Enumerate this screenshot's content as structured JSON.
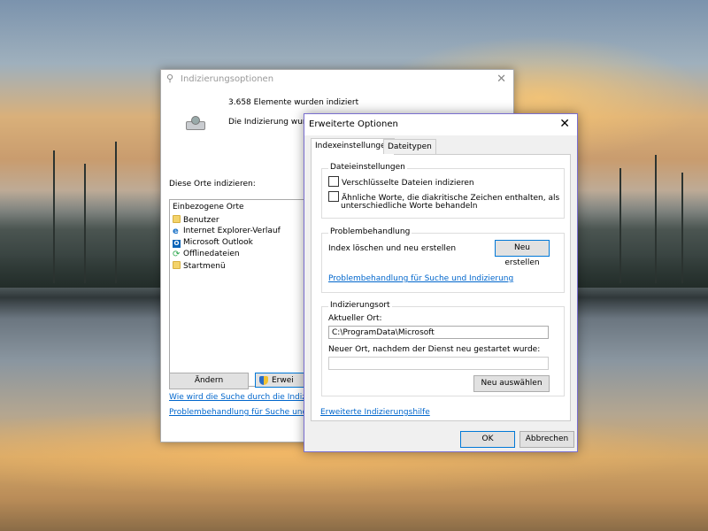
{
  "indexing_window": {
    "title": "Indizierungsoptionen",
    "title_icon": "magnifier-icon",
    "close_glyph": "✕",
    "count_text": "3.658 Elemente wurden indiziert",
    "status_text": "Die Indizierung wurde",
    "locations_label": "Diese Orte indizieren:",
    "locations_header": "Einbezogene Orte",
    "locations": [
      {
        "label": "Benutzer",
        "icon": "folder-icon"
      },
      {
        "label": "Internet Explorer-Verlauf",
        "icon": "internet-explorer-icon"
      },
      {
        "label": "Microsoft Outlook",
        "icon": "outlook-icon"
      },
      {
        "label": "Offlinedateien",
        "icon": "sync-icon"
      },
      {
        "label": "Startmenü",
        "icon": "folder-icon"
      }
    ],
    "modify_button": "Ändern",
    "advanced_button": "Erwei",
    "link_how_search": "Wie wird die Suche durch die Indizierun",
    "link_troubleshoot": "Problembehandlung für Suche und Indizi"
  },
  "advanced_dialog": {
    "title": "Erweiterte Optionen",
    "close_glyph": "✕",
    "tabs": [
      {
        "label": "Indexeinstellungen",
        "active": true
      },
      {
        "label": "Dateitypen",
        "active": false
      }
    ],
    "file_settings": {
      "title": "Dateieinstellungen",
      "encrypted_label": "Verschlüsselte Dateien indizieren",
      "encrypted_checked": false,
      "diacritics_label_line1": "Ähnliche Worte, die diakritische Zeichen enthalten, als",
      "diacritics_label_line2": "unterschiedliche Worte behandeln",
      "diacritics_checked": false
    },
    "troubleshooting": {
      "title": "Problembehandlung",
      "rebuild_label": "Index löschen und neu erstellen",
      "rebuild_button": "Neu erstellen",
      "troubleshoot_link": "Problembehandlung für Suche und Indizierung"
    },
    "index_location": {
      "title": "Indizierungsort",
      "current_label": "Aktueller Ort:",
      "current_value": "C:\\ProgramData\\Microsoft",
      "new_label": "Neuer Ort, nachdem der Dienst neu gestartet wurde:",
      "new_value": "",
      "select_new_button": "Neu auswählen"
    },
    "help_link": "Erweiterte Indizierungshilfe",
    "ok_button": "OK",
    "cancel_button": "Abbrechen"
  },
  "colors": {
    "link": "#0066cc",
    "accent_border": "#0078d7",
    "dialog_border": "#7a6fd0"
  }
}
